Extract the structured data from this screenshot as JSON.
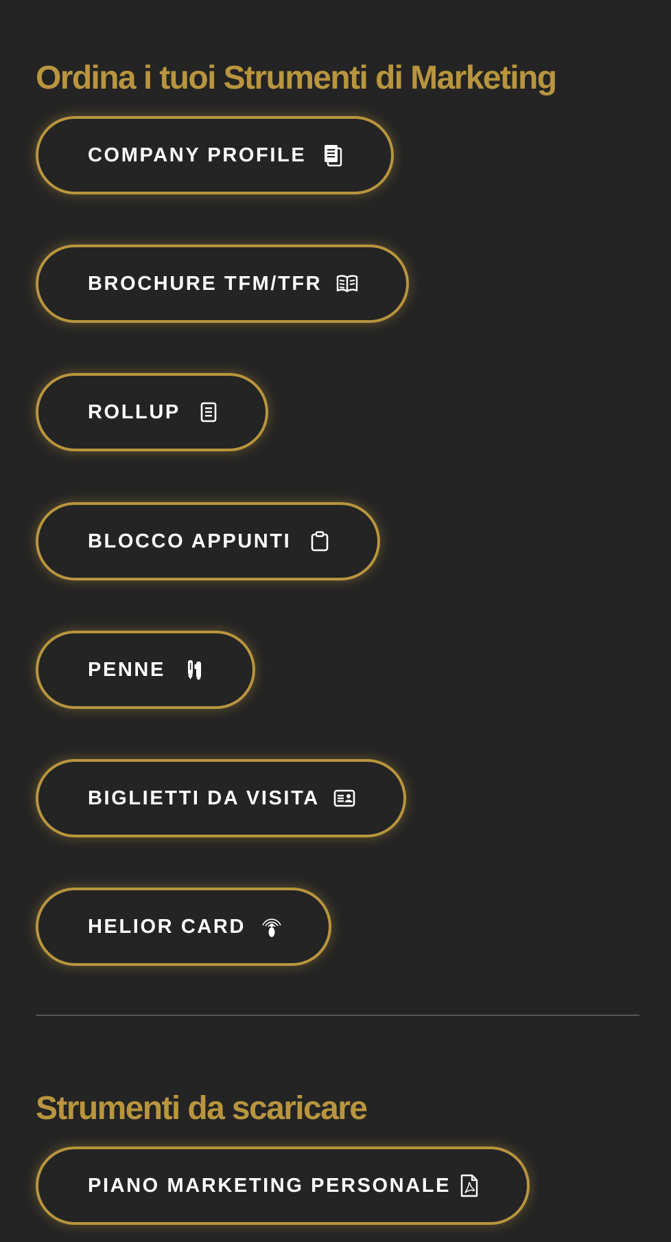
{
  "sections": {
    "order_title": "Ordina i tuoi Strumenti di Marketing",
    "download_title": "Strumenti da scaricare"
  },
  "order_buttons": [
    {
      "label": "COMPANY PROFILE",
      "icon": "documents-icon"
    },
    {
      "label": "BROCHURE TFM/TFR",
      "icon": "open-book-icon"
    },
    {
      "label": "ROLLUP",
      "icon": "document-lines-icon"
    },
    {
      "label": "BLOCCO APPUNTI",
      "icon": "clipboard-icon"
    },
    {
      "label": "PENNE",
      "icon": "pens-icon"
    },
    {
      "label": "BIGLIETTI DA VISITA",
      "icon": "id-card-icon"
    },
    {
      "label": "HELIOR CARD",
      "icon": "contactless-nfc-icon"
    }
  ],
  "download_buttons": [
    {
      "label": "PIANO MARKETING PERSONALE",
      "icon": "pdf-file-icon"
    }
  ],
  "colors": {
    "background": "#242424",
    "accent_gold": "#B8953E",
    "text": "#FFFFFF",
    "divider": "#555555"
  }
}
